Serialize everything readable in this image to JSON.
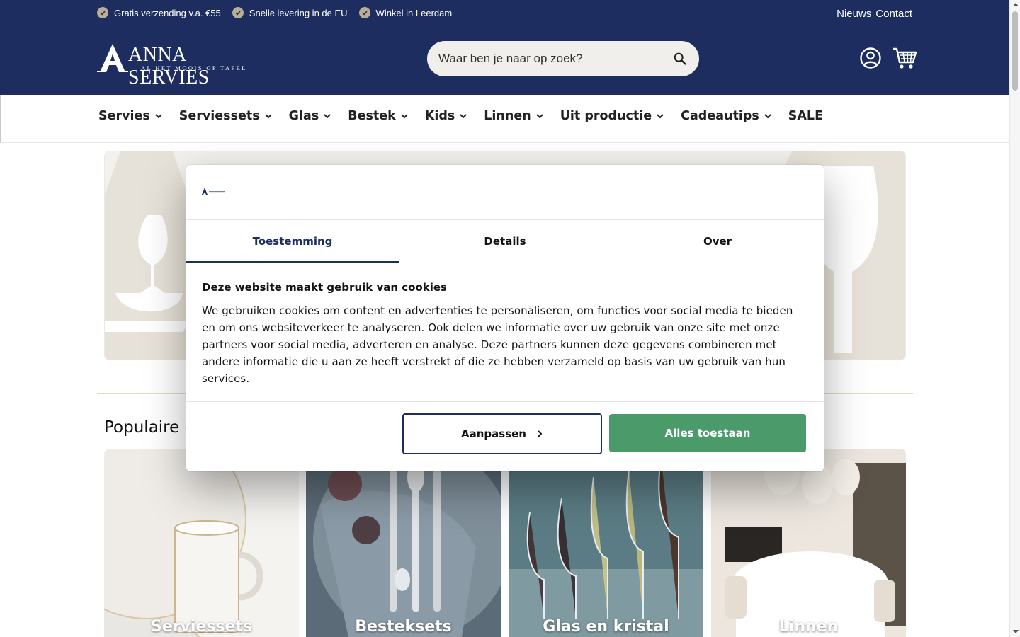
{
  "header": {
    "usps": [
      {
        "label": "Gratis verzending v.a. €55",
        "icon": "check-icon"
      },
      {
        "label": "Snelle levering in de EU",
        "icon": "check-icon"
      },
      {
        "label": "Winkel in Leerdam",
        "icon": "check-icon"
      }
    ],
    "links": [
      "Nieuws",
      "Contact"
    ],
    "logo": {
      "name": "ANNA SERVIES",
      "tagline": "AL HET MOOIS OP TAFEL"
    },
    "search": {
      "placeholder": "Waar ben je naar op zoek?"
    },
    "colors": {
      "navy": "#1d2d5f",
      "usp_check": "#b9ad96"
    }
  },
  "nav": {
    "items": [
      {
        "label": "Servies",
        "dropdown": true
      },
      {
        "label": "Serviessets",
        "dropdown": true
      },
      {
        "label": "Glas",
        "dropdown": true
      },
      {
        "label": "Bestek",
        "dropdown": true
      },
      {
        "label": "Kids",
        "dropdown": true
      },
      {
        "label": "Linnen",
        "dropdown": true
      },
      {
        "label": "Uit productie",
        "dropdown": true
      },
      {
        "label": "Cadeautips",
        "dropdown": true
      },
      {
        "label": "SALE",
        "dropdown": false
      }
    ]
  },
  "main": {
    "section_title": "Populaire c",
    "categories": [
      {
        "label": "Serviessets"
      },
      {
        "label": "Besteksets"
      },
      {
        "label": "Glas en kristal"
      },
      {
        "label": "Linnen"
      }
    ]
  },
  "cookie_modal": {
    "tabs": [
      {
        "label": "Toestemming",
        "active": true
      },
      {
        "label": "Details",
        "active": false
      },
      {
        "label": "Over",
        "active": false
      }
    ],
    "title": "Deze website maakt gebruik van cookies",
    "body": "We gebruiken cookies om content en advertenties te personaliseren, om functies voor social media te bieden en om ons websiteverkeer te analyseren. Ook delen we informatie over uw gebruik van onze site met onze partners voor social media, adverteren en analyse. Deze partners kunnen deze gegevens combineren met andere informatie die u aan ze heeft verstrekt of die ze hebben verzameld op basis van uw gebruik van hun services.",
    "customize_label": "Aanpassen",
    "allow_all_label": "Alles toestaan",
    "colors": {
      "accent": "#1d2d5f",
      "allow": "#4a9a6a"
    }
  }
}
